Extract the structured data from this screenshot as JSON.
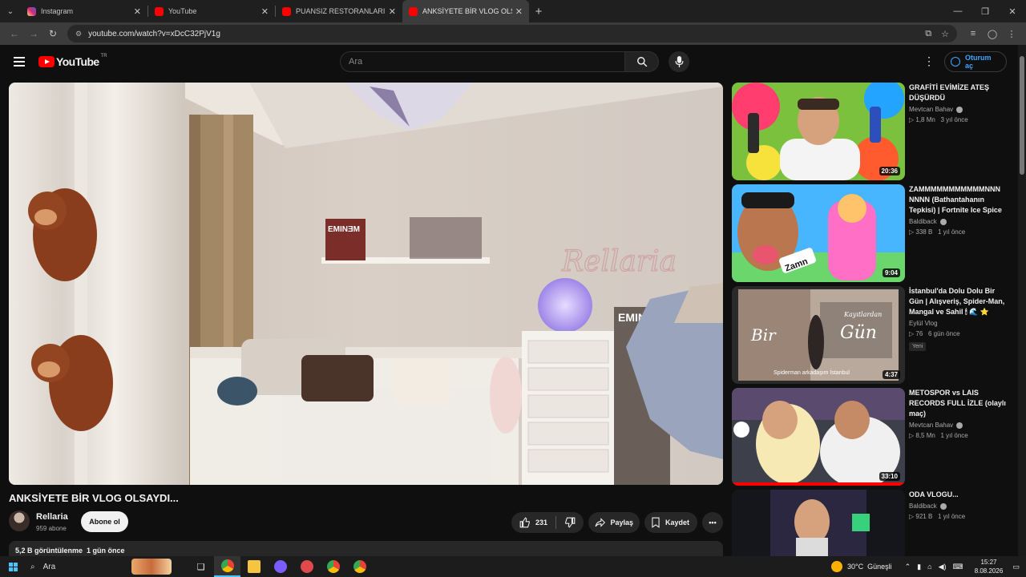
{
  "browser": {
    "tabs": [
      {
        "title": "Instagram",
        "color": "#d6249f",
        "active": false
      },
      {
        "title": "YouTube",
        "color": "#ff0000",
        "active": false
      },
      {
        "title": "PUANSIZ RESTORANLARI EMİR",
        "color": "#ff0000",
        "active": false
      },
      {
        "title": "ANKSİYETE BİR VLOG OLSAYDI...",
        "color": "#ff0000",
        "active": true
      }
    ],
    "url": "youtube.com/watch?v=xDcC32PjV1g"
  },
  "masthead": {
    "logo_text": "YouTube",
    "country_code": "TR",
    "search_placeholder": "Ara",
    "signin_label": "Oturum aç"
  },
  "video": {
    "title": "ANKSİYETE BİR VLOG OLSAYDI...",
    "channel": "Rellaria",
    "subscribers": "959 abone",
    "subscribe_label": "Abone ol",
    "likes": "231",
    "share_label": "Paylaş",
    "save_label": "Kaydet",
    "stats": "5,2 B görüntülenme  1 gün önce",
    "scene_text": {
      "poster": "EMINƎM",
      "wall_sign": "Rellaria",
      "drawer": "EMIN"
    }
  },
  "recommendations": [
    {
      "title": "GRAFİTİ EVİMİZE ATEŞ DÜŞÜRDÜ",
      "channel": "Mevtcan Bahav",
      "verified": true,
      "meta": "▷ 1,8 Mn   3 yıl önce",
      "duration": "20:36",
      "badge": ""
    },
    {
      "title": "ZAMMMMMMMMMMMNNN NNNN (Bathantahanın Tepkisi) | Fortnite Ice Spice ...",
      "channel": "Baldiback",
      "verified": true,
      "meta": "▷ 338 B   1 yıl önce",
      "duration": "9:04",
      "badge": "",
      "thumb_text": "Zamn"
    },
    {
      "title": "İstanbul'da Dolu Dolu Bir Gün | Alışveriş, Spider-Man, Mangal ve Sahil 🕯 🌊 ⭐",
      "channel": "Eylül Vlog",
      "verified": false,
      "meta": "▷ 76   6 gün önce",
      "duration": "4:37",
      "badge": "Yeni",
      "thumb_text": [
        "Bir",
        "Gün",
        "Kayıtlardan",
        "Spiderman arkadaşım İstanbul"
      ]
    },
    {
      "title": "METOSPOR vs LAIS RECORDS FULL İZLE (olaylı maç)",
      "channel": "Mevtcan Bahav",
      "verified": true,
      "meta": "▷ 8,5 Mn   1 yıl önce",
      "duration": "33:10",
      "badge": ""
    },
    {
      "title": "ODA VLOGU...",
      "channel": "Baldiback",
      "verified": true,
      "meta": "▷ 921 B   1 yıl önce",
      "duration": "",
      "badge": ""
    }
  ],
  "taskbar": {
    "search_label": "Ara",
    "weather": "30°C  Güneşli",
    "time": "15:27",
    "date": "8.08.2026"
  }
}
